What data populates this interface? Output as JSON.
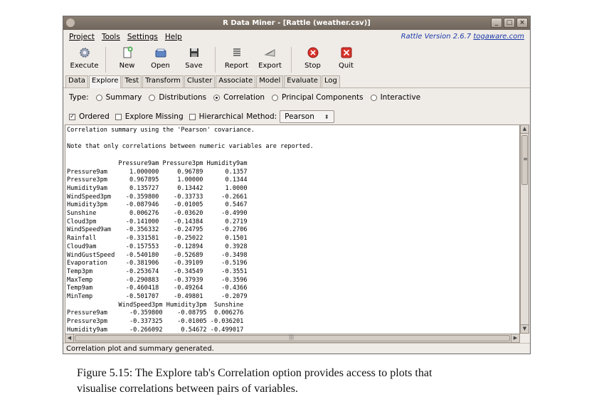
{
  "window": {
    "title": "R Data Miner - [Rattle (weather.csv)]",
    "controls": {
      "minimize": "_",
      "maximize": "□",
      "close": "×"
    }
  },
  "menubar": {
    "items": [
      {
        "label": "Project"
      },
      {
        "label": "Tools"
      },
      {
        "label": "Settings"
      },
      {
        "label": "Help"
      }
    ],
    "version_text": "Rattle Version 2.6.7",
    "version_link": "togaware.com"
  },
  "toolbar": {
    "buttons": [
      {
        "label": "Execute",
        "icon": "gear-icon"
      },
      {
        "label": "New",
        "icon": "new-document-icon"
      },
      {
        "label": "Open",
        "icon": "folder-open-icon"
      },
      {
        "label": "Save",
        "icon": "floppy-disk-icon"
      },
      {
        "label": "Report",
        "icon": "report-icon"
      },
      {
        "label": "Export",
        "icon": "export-icon"
      },
      {
        "label": "Stop",
        "icon": "stop-icon"
      },
      {
        "label": "Quit",
        "icon": "quit-icon"
      }
    ]
  },
  "tabs": [
    {
      "label": "Data"
    },
    {
      "label": "Explore",
      "active": true
    },
    {
      "label": "Test"
    },
    {
      "label": "Transform"
    },
    {
      "label": "Cluster"
    },
    {
      "label": "Associate"
    },
    {
      "label": "Model"
    },
    {
      "label": "Evaluate"
    },
    {
      "label": "Log"
    }
  ],
  "explore": {
    "type_label": "Type:",
    "types": [
      {
        "label": "Summary",
        "selected": false
      },
      {
        "label": "Distributions",
        "selected": false
      },
      {
        "label": "Correlation",
        "selected": true
      },
      {
        "label": "Principal Components",
        "selected": false
      },
      {
        "label": "Interactive",
        "selected": false
      }
    ],
    "options": [
      {
        "label": "Ordered",
        "checked": true
      },
      {
        "label": "Explore Missing",
        "checked": false
      },
      {
        "label": "Hierarchical",
        "checked": false
      }
    ],
    "method_label": "Method:",
    "method_value": "Pearson"
  },
  "output_text": "Correlation summary using the 'Pearson' covariance.\n\nNote that only correlations between numeric variables are reported.\n\n              Pressure9am Pressure3pm Humidity9am\nPressure9am      1.000000     0.96789      0.1357\nPressure3pm      0.967895     1.00000      0.1344\nHumidity9am      0.135727     0.13442      1.0000\nWindSpeed3pm    -0.359800    -0.33733     -0.2661\nHumidity3pm     -0.087946    -0.01005      0.5467\nSunshine         0.006276    -0.03620     -0.4990\nCloud3pm        -0.141000    -0.14384      0.2719\nWindSpeed9am    -0.356332    -0.24795     -0.2706\nRainfall        -0.331581    -0.25022      0.1501\nCloud9am        -0.157553    -0.12894      0.3928\nWindGustSpeed   -0.540180    -0.52689     -0.3498\nEvaporation     -0.381906    -0.39109     -0.5196\nTemp3pm         -0.253674    -0.34549     -0.3551\nMaxTemp         -0.290883    -0.37939     -0.3596\nTemp9am         -0.460418    -0.49264     -0.4366\nMinTemp         -0.501707    -0.49801     -0.2079\n              WindSpeed3pm Humidity3pm  Sunshine\nPressure9am      -0.359800    -0.08795  0.006276\nPressure3pm      -0.337325    -0.01005 -0.036201\nHumidity9am      -0.266092     0.54672 -0.499017",
  "status": "Correlation plot and summary generated.",
  "caption": {
    "line1": "Figure 5.15: The Explore tab's Correlation option provides access to plots that",
    "line2": "visualise correlations between pairs of variables."
  }
}
